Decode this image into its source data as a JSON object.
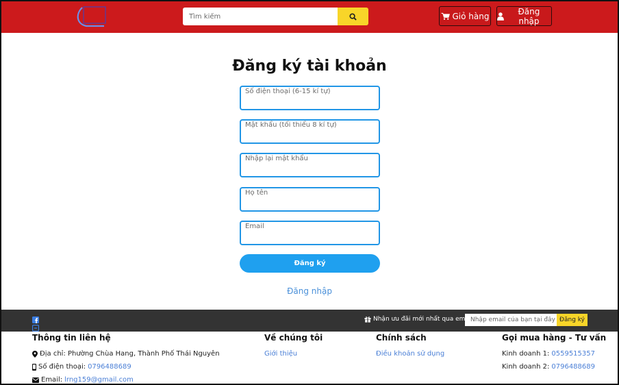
{
  "colors": {
    "header_bg": "#cc1a1c",
    "search_button": "#f8d529",
    "field_border": "#2196e6",
    "submit_bg": "#1fa0ef",
    "link": "#4a90d9",
    "dark_bar": "#333333"
  },
  "header": {
    "search_placeholder": "Tìm kiếm",
    "cart_label": "Giỏ hàng",
    "login_label": "Đăng nhập",
    "search_icon": "search-icon",
    "cart_icon": "cart-icon",
    "user_icon": "user-icon"
  },
  "form": {
    "title": "Đăng ký tài khoản",
    "phone_placeholder": "Số điện thoại (6-15 kí tự)",
    "password_placeholder": "Mật khẩu (tối thiểu 8 kí tự)",
    "confirm_placeholder": "Nhập lại mật khẩu",
    "name_placeholder": "Họ tên",
    "email_placeholder": "Email",
    "submit_label": "Đăng ký",
    "login_link": "Đăng nhập"
  },
  "newsletter": {
    "label": "Nhận ưu đãi mới nhất qua email",
    "placeholder": "Nhập email của bạn tại đây",
    "button": "Đăng ký"
  },
  "footer": {
    "contact": {
      "heading": "Thông tin liên hệ",
      "address_label": "Địa chỉ: Phường Chùa Hang, Thành Phố Thái Nguyên",
      "phone_label": "Số điện thoại:",
      "phone_value": "0796488689",
      "email_label": "Email:",
      "email_value": "lrng159@gmail.com"
    },
    "about": {
      "heading": "Về chúng tôi",
      "link": "Giới thiệu"
    },
    "policy": {
      "heading": "Chính sách",
      "link": "Điều khoản sử dụng"
    },
    "hotline": {
      "heading": "Gọi mua hàng - Tư vấn",
      "sales1_label": "Kinh doanh 1:",
      "sales1_value": "0559515357",
      "sales2_label": "Kinh doanh 2:",
      "sales2_value": "0796488689"
    }
  }
}
